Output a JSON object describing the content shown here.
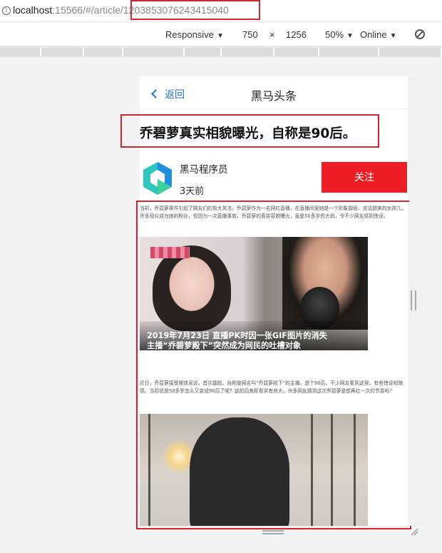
{
  "browser": {
    "url_host": "localhost",
    "url_rest": ":15566/#/article/",
    "url_id": "1203853076243415040"
  },
  "device_toolbar": {
    "preset": "Responsive",
    "width": "750",
    "times": "×",
    "height": "1256",
    "zoom": "50%",
    "network": "Online"
  },
  "page": {
    "back_label": "返回",
    "nav_title": "黑马头条",
    "article_title": "乔碧萝真实相貌曝光，自称是90后。",
    "author": "黑马程序员",
    "time_ago": "3天前",
    "follow_label": "关注",
    "paragraph1": "当初，乔碧萝事件引起了网友们的极大关注。乔碧萝作为一名网红直播，在直播间里她是一个形象靓丽、说话甜美的女孩儿，许多观众成为她的粉丝，但因为一次直播事故，乔碧萝的真实容貌曝光，竟是50多岁的大妈，令不少网友感到惊讶。",
    "image1_caption_line1": "2019年7月23日  直播PK时因一张GIF图片的消失",
    "image1_caption_line2": "主播“乔碧萝殿下”突然成为网民的吐槽对象",
    "paragraph2": "近日，乔碧萝接受媒体采访，首次露脸。自称是网名叫“乔碧萝殿下”的主播，是个90后。不少网友看到这里，有些惊讶和随感。当初说是50多岁怎么又变成90后了呢？这前后差距看实有些大，许多网友猜测这次乔碧萝是想再红一次的节奏吗？"
  },
  "colors": {
    "annotation_red": "#d0262e",
    "follow_button": "#ee1c25",
    "link_blue": "#1e6fd9"
  },
  "icons": [
    "info-icon",
    "dropdown-triangle-icon",
    "rotate-icon",
    "chevron-left-icon",
    "brand-logo-icon"
  ]
}
